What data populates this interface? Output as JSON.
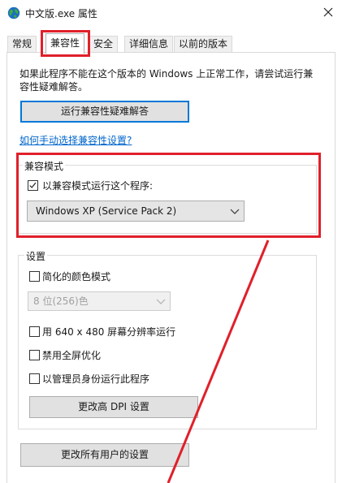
{
  "window": {
    "title": "中文版.exe 属性",
    "close_symbol": "✕"
  },
  "tabs": [
    {
      "label": "常规"
    },
    {
      "label": "兼容性"
    },
    {
      "label": "安全"
    },
    {
      "label": "详细信息"
    },
    {
      "label": "以前的版本"
    }
  ],
  "intro": {
    "line1": "如果此程序不能在这个版本的 Windows 上正常工作，请尝试运行兼",
    "line2": "容性疑难解答。"
  },
  "troubleshooter_button": "运行兼容性疑难解答",
  "manual_link": "如何手动选择兼容性设置?",
  "compat_mode": {
    "legend": "兼容模式",
    "checkbox_label": "以兼容模式运行这个程序:",
    "checked": true,
    "selected_os": "Windows XP (Service Pack 2)"
  },
  "settings": {
    "legend": "设置",
    "reduced_color_label": "简化的颜色模式",
    "color_depth_value": "8 位(256)色",
    "res_640_label": "用 640 x 480 屏幕分辨率运行",
    "disable_fullscreen_label": "禁用全屏优化",
    "run_as_admin_label": "以管理员身份运行此程序",
    "dpi_button": "更改高 DPI 设置"
  },
  "all_users_button": "更改所有用户的设置",
  "colors": {
    "accent": "#0078d7",
    "annotation_red": "#e0202a",
    "link": "#0066cc"
  }
}
